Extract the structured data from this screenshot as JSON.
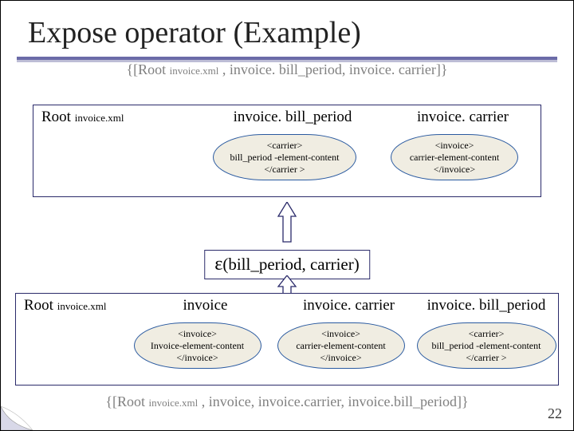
{
  "title": "Expose operator (Example)",
  "top_set": {
    "open": "{[Root ",
    "root_sub": "invoice.xml",
    "rest": " , invoice. bill_period, invoice. carrier]}"
  },
  "stage_top": {
    "headers": {
      "root_prefix": "Root ",
      "root_sub": "invoice.xml",
      "h2": "invoice. bill_period",
      "h3": "invoice. carrier"
    },
    "bubbles": {
      "b2": {
        "l1": "<carrier>",
        "l2": "bill_period -element-content",
        "l3": "</carrier >"
      },
      "b3": {
        "l1": "<invoice>",
        "l2": "carrier-element-content",
        "l3": "</invoice>"
      }
    }
  },
  "operator": {
    "eps": "ε",
    "args": "(bill_period, carrier)"
  },
  "stage_bot": {
    "headers": {
      "root_prefix": "Root ",
      "root_sub": "invoice.xml",
      "h2": "invoice",
      "h3": "invoice. carrier",
      "h4": "invoice. bill_period"
    },
    "bubbles": {
      "b2": {
        "l1": "<invoice>",
        "l2": "Invoice-element-content",
        "l3": "</invoice>"
      },
      "b3": {
        "l1": "<invoice>",
        "l2": "carrier-element-content",
        "l3": "</invoice>"
      },
      "b4": {
        "l1": "<carrier>",
        "l2": "bill_period -element-content",
        "l3": "</carrier >"
      }
    }
  },
  "bottom_set": {
    "open": "{[Root ",
    "root_sub": "invoice.xml",
    "rest": " , invoice, invoice.carrier, invoice.bill_period]}"
  },
  "page": "22"
}
